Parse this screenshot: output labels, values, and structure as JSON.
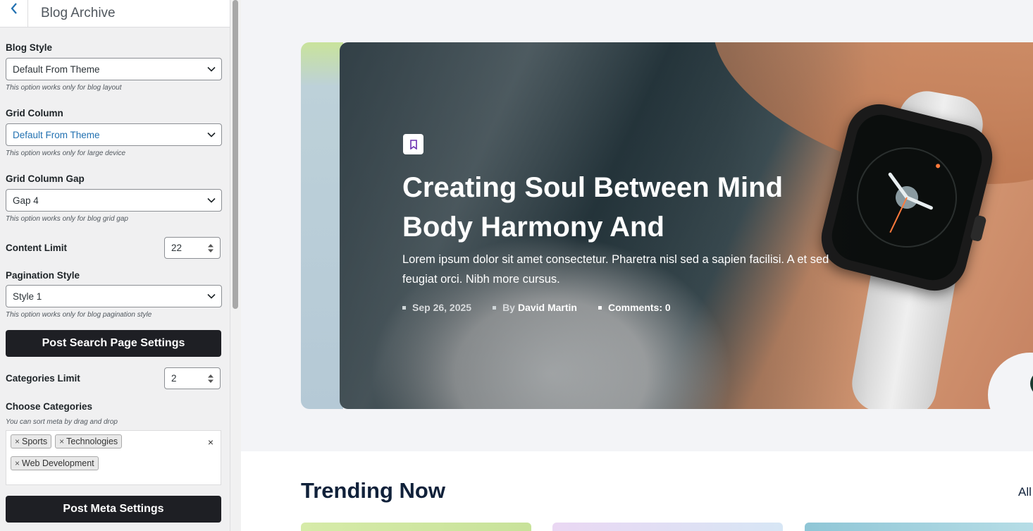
{
  "sidebar": {
    "title": "Blog Archive",
    "blog_style": {
      "label": "Blog Style",
      "value": "Default From Theme",
      "hint": "This option works only for blog layout"
    },
    "grid_column": {
      "label": "Grid Column",
      "value": "Default From Theme",
      "hint": "This option works only for large device"
    },
    "grid_gap": {
      "label": "Grid Column Gap",
      "value": "Gap 4",
      "hint": "This option works only for blog grid gap"
    },
    "content_limit": {
      "label": "Content Limit",
      "value": "22"
    },
    "pagination": {
      "label": "Pagination Style",
      "value": "Style 1",
      "hint": "This option works only for blog pagination style"
    },
    "search_settings_button": "Post Search Page Settings",
    "categories_limit": {
      "label": "Categories Limit",
      "value": "2"
    },
    "choose_categories": {
      "label": "Choose Categories",
      "hint": "You can sort meta by drag and drop",
      "tags": [
        "Sports",
        "Technologies",
        "Web Development"
      ],
      "remove_symbol": "×"
    },
    "meta_settings_button": "Post Meta Settings"
  },
  "hero": {
    "title": "Creating Soul Between Mind Body Harmony And",
    "excerpt": "Lorem ipsum dolor sit amet consectetur. Pharetra nisl sed a sapien facilisi. A et sed feugiat orci. Nibh more cursus.",
    "date": "Sep 26, 2025",
    "author_prefix": "By",
    "author": "David Martin",
    "comments": "Comments: 0"
  },
  "trending": {
    "heading": "Trending Now",
    "all_link": "All"
  },
  "colors": {
    "dark_button": "#1e1f24",
    "heading": "#10213a",
    "select_blue": "#2271b1"
  }
}
